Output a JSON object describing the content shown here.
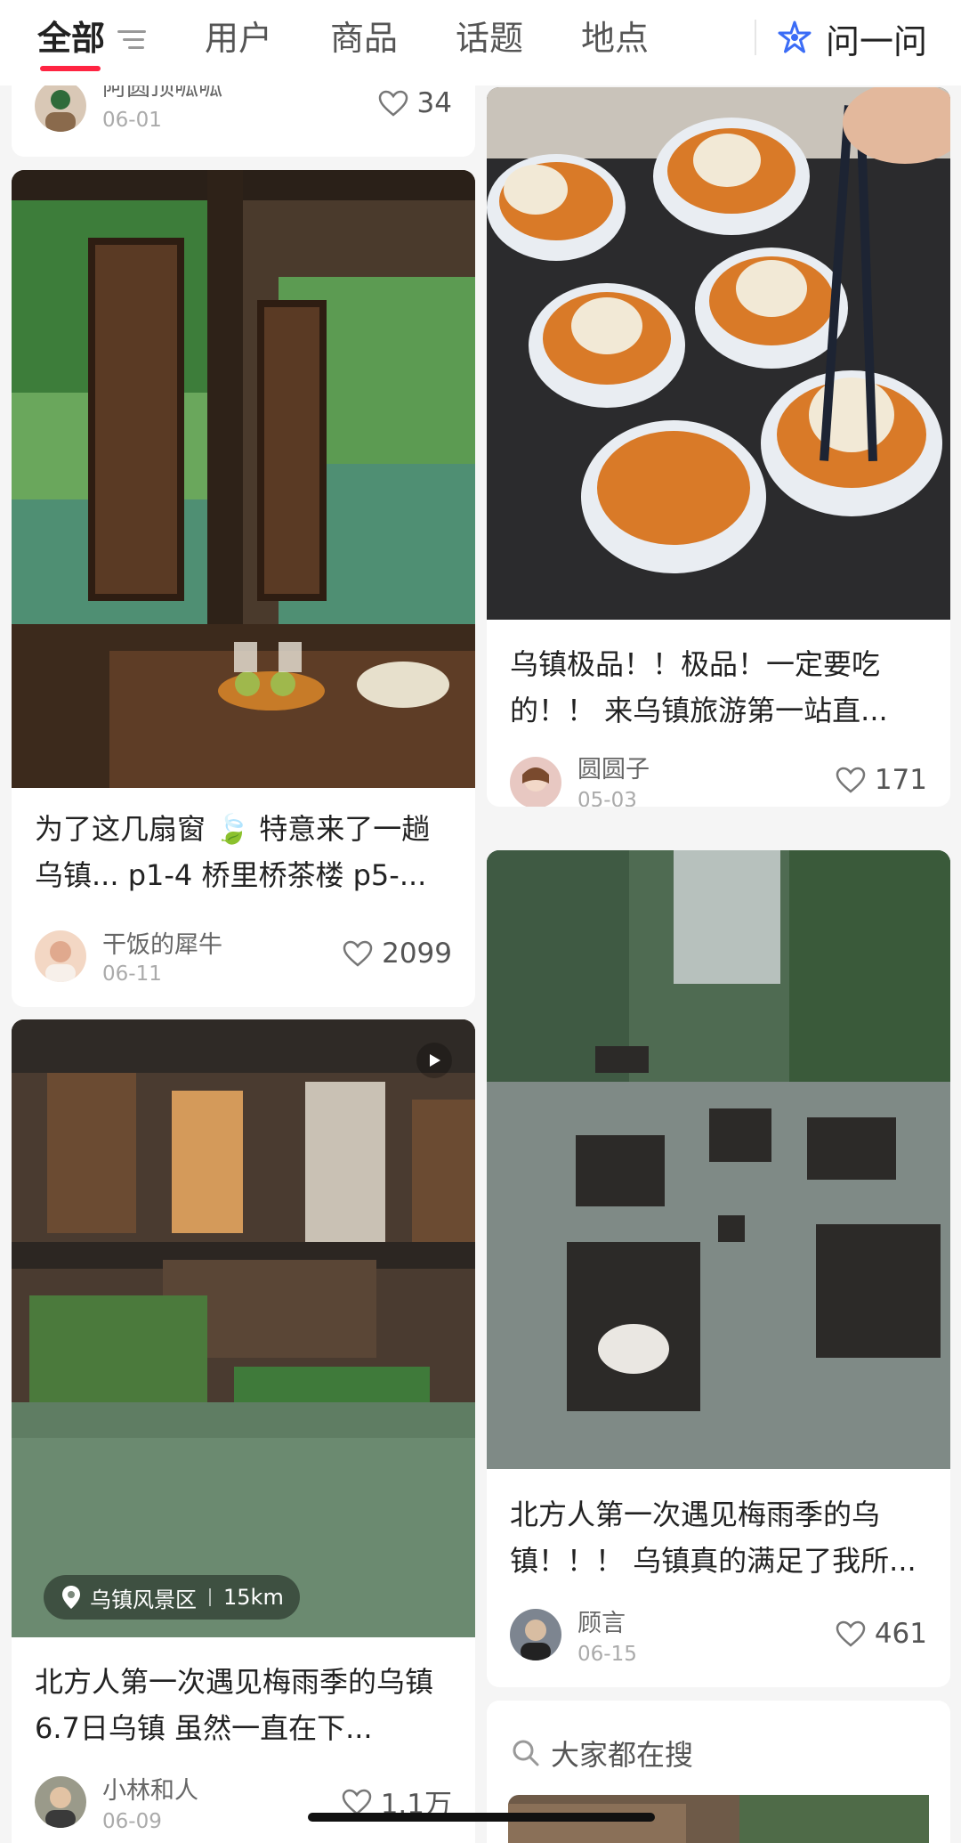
{
  "topbar": {
    "tabs": [
      "全部",
      "用户",
      "商品",
      "话题",
      "地点"
    ],
    "ask_label": "问一问"
  },
  "cards": {
    "c1": {
      "author": "阿圆顶呱呱",
      "date": "06-01",
      "likes": "34"
    },
    "c2": {
      "title": "为了这几扇窗 🍃 特意来了一趟乌镇... p1-4 桥里桥茶楼 p5-...",
      "author": "干饭的犀牛",
      "date": "06-11",
      "likes": "2099"
    },
    "c3": {
      "title": "北方人第一次遇见梅雨季的乌镇 6.7日乌镇 虽然一直在下...",
      "author": "小林和人",
      "date": "06-09",
      "likes": "1.1万",
      "location": "乌镇风景区",
      "distance": "15km"
    },
    "c4": {
      "title": "乌镇极品！！极品！一定要吃的！！ 来乌镇旅游第一站直...",
      "author": "圆圆子",
      "date": "05-03",
      "likes": "171"
    },
    "c5": {
      "title": "北方人第一次遇见梅雨季的乌镇！！！ 乌镇真的满足了我所...",
      "author": "顾言",
      "date": "06-15",
      "likes": "461"
    },
    "c6": {
      "search_label": "大家都在搜"
    }
  },
  "colors": {
    "accent": "#ff2442",
    "ask_icon": "#3b6cf6"
  }
}
